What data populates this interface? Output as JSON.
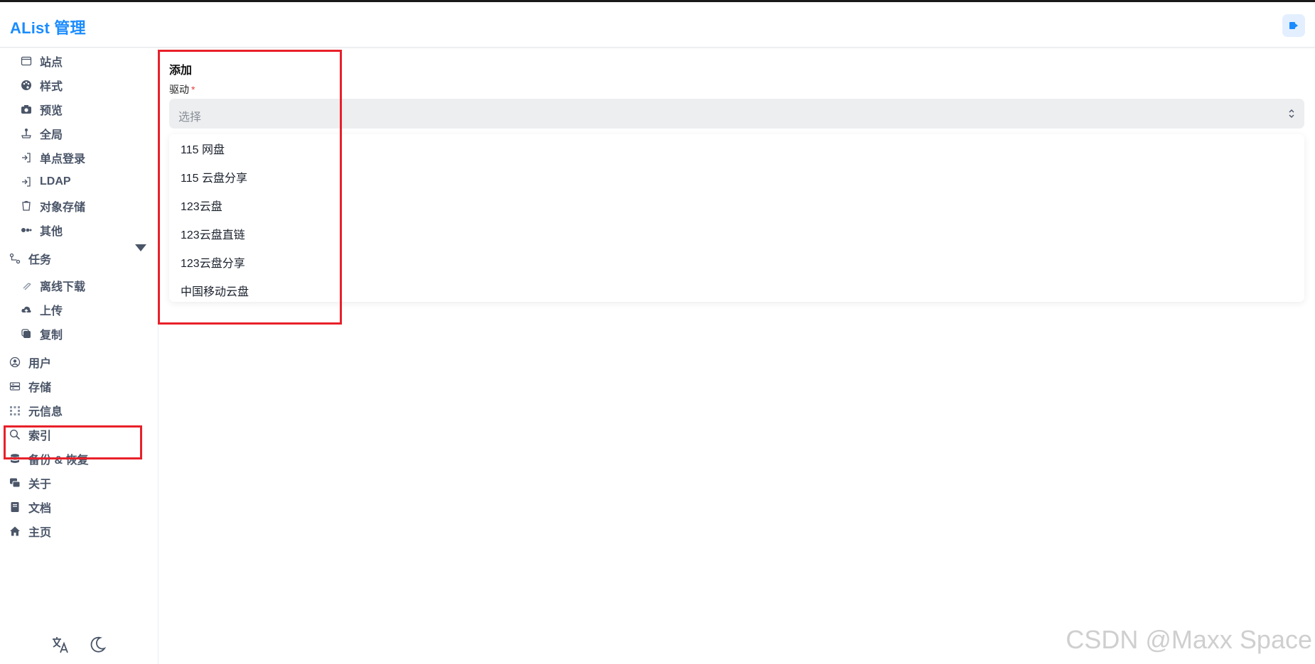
{
  "header": {
    "brand": "AList 管理",
    "logout_icon": "logout-icon"
  },
  "sidebar": {
    "settings_items": [
      {
        "label": "站点",
        "icon": "browser-icon"
      },
      {
        "label": "样式",
        "icon": "palette-icon"
      },
      {
        "label": "预览",
        "icon": "camera-icon"
      },
      {
        "label": "全局",
        "icon": "joystick-icon"
      },
      {
        "label": "单点登录",
        "icon": "login-icon"
      },
      {
        "label": "LDAP",
        "icon": "login-icon"
      },
      {
        "label": "对象存储",
        "icon": "bucket-icon"
      },
      {
        "label": "其他",
        "icon": "dots-icon"
      }
    ],
    "tasks": {
      "label": "任务",
      "icon": "flow-icon",
      "expanded": true
    },
    "task_items": [
      {
        "label": "离线下载",
        "icon": "magnet-icon"
      },
      {
        "label": "上传",
        "icon": "cloud-upload-icon"
      },
      {
        "label": "复制",
        "icon": "copy-icon"
      }
    ],
    "top_items": [
      {
        "label": "用户",
        "icon": "user-circle-icon"
      },
      {
        "label": "存储",
        "icon": "storage-icon"
      },
      {
        "label": "元信息",
        "icon": "meta-icon"
      },
      {
        "label": "索引",
        "icon": "search-icon"
      },
      {
        "label": "备份 & 恢复",
        "icon": "database-icon"
      },
      {
        "label": "关于",
        "icon": "chat-icon"
      },
      {
        "label": "文档",
        "icon": "book-icon"
      },
      {
        "label": "主页",
        "icon": "home-icon"
      }
    ],
    "footer": [
      "translate-icon",
      "moon-icon"
    ]
  },
  "main": {
    "title": "添加",
    "field_label": "驱动",
    "required_mark": "*",
    "select_placeholder": "选择",
    "options": [
      "115 网盘",
      "115 云盘分享",
      "123云盘",
      "123云盘直链",
      "123云盘分享",
      "中国移动云盘"
    ]
  },
  "watermark": "CSDN @Maxx Space",
  "colors": {
    "brand": "#1a8cff",
    "highlight": "#e8202a"
  }
}
